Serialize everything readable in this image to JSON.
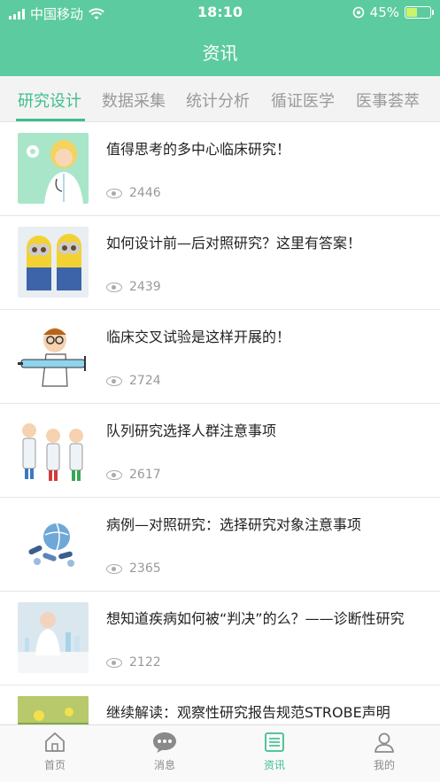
{
  "status_bar": {
    "carrier": "中国移动",
    "time": "18:10",
    "battery_percent": "45%",
    "battery_level": 0.45,
    "icons": [
      "signal-icon",
      "wifi-icon",
      "orientation-lock-icon",
      "battery-icon"
    ]
  },
  "header": {
    "title": "资讯"
  },
  "tabs": [
    {
      "label": "研究设计",
      "active": true
    },
    {
      "label": "数据采集",
      "active": false
    },
    {
      "label": "统计分析",
      "active": false
    },
    {
      "label": "循证医学",
      "active": false
    },
    {
      "label": "医事荟萃",
      "active": false
    }
  ],
  "articles": [
    {
      "title": "值得思考的多中心临床研究！",
      "views": "2446",
      "thumb": "doctor-illustration"
    },
    {
      "title": "如何设计前—后对照研究？这里有答案！",
      "views": "2439",
      "thumb": "minions-image"
    },
    {
      "title": "临床交叉试验是这样开展的！",
      "views": "2724",
      "thumb": "syringe-doctor-cartoon"
    },
    {
      "title": "队列研究选择人群注意事项",
      "views": "2617",
      "thumb": "three-doctors-cartoon"
    },
    {
      "title": "病例—对照研究：选择研究对象注意事项",
      "views": "2365",
      "thumb": "globe-pills-image"
    },
    {
      "title": "想知道疾病如何被“判决”的么？——诊断性研究",
      "views": "2122",
      "thumb": "lab-scientist-photo"
    },
    {
      "title": "继续解读：观察性研究报告规范STROBE声明",
      "views": "",
      "thumb": "flowers-photo"
    }
  ],
  "tabbar": [
    {
      "label": "首页",
      "icon": "home-icon",
      "active": false
    },
    {
      "label": "消息",
      "icon": "message-icon",
      "active": false
    },
    {
      "label": "资讯",
      "icon": "news-icon",
      "active": true
    },
    {
      "label": "我的",
      "icon": "profile-icon",
      "active": false
    }
  ],
  "colors": {
    "primary": "#5ccb9f",
    "accent": "#3dbf8d"
  }
}
